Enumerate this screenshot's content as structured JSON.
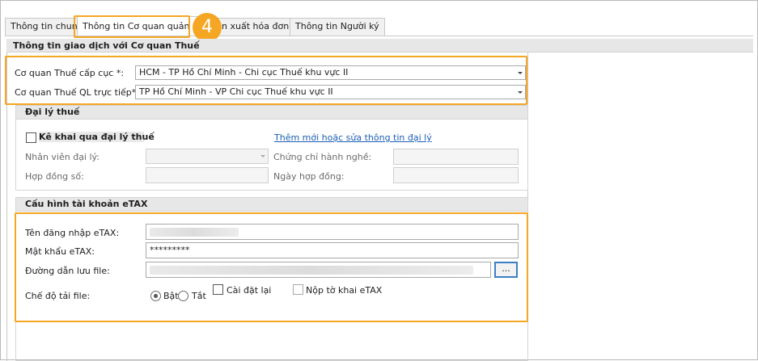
{
  "tabs": [
    {
      "label": "Thông tin chung",
      "active": false
    },
    {
      "label": "Thông tin Cơ quan quản lý",
      "active": true
    },
    {
      "label": "in xuất hóa đơn",
      "active": false
    },
    {
      "label": "Thông tin Người ký",
      "active": false
    }
  ],
  "step_badge": "4",
  "section_title": "Thông tin giao dịch với Cơ quan Thuế",
  "tax_office": {
    "parent_label": "Cơ quan Thuế cấp cục *:",
    "parent_value": "HCM - TP Hồ Chí Minh - Chi cục Thuế khu vực II",
    "direct_label": "Cơ quan Thuế QL trực tiếp*:",
    "direct_value": "TP Hồ Chí Minh - VP Chi cục Thuế khu vực II"
  },
  "tax_agent": {
    "header": "Đại lý thuế",
    "declare_checkbox_label": "Kê khai qua đại lý thuế",
    "add_link": "Thêm mới hoặc sửa thông tin đại lý",
    "staff_label": "Nhân viên đại lý:",
    "certificate_label": "Chứng chỉ hành nghề:",
    "contract_label": "Hợp đồng số:",
    "contract_date_label": "Ngày hợp đồng:"
  },
  "etax": {
    "header": "Cấu hình tài khoản eTAX",
    "username_label": "Tên đăng nhập eTAX:",
    "password_label": "Mật khẩu eTAX:",
    "password_value": "*********",
    "path_label": "Đường dẫn lưu file:",
    "browse_label": "...",
    "download_mode_label": "Chế độ tải file:",
    "on_label": "Bật",
    "off_label": "Tắt",
    "download_mode": "on",
    "reinstall_label": "Cài đặt lại",
    "submit_label": "Nộp tờ khai eTAX"
  },
  "colors": {
    "highlight": "#f5a623",
    "link": "#1a5fb4"
  }
}
